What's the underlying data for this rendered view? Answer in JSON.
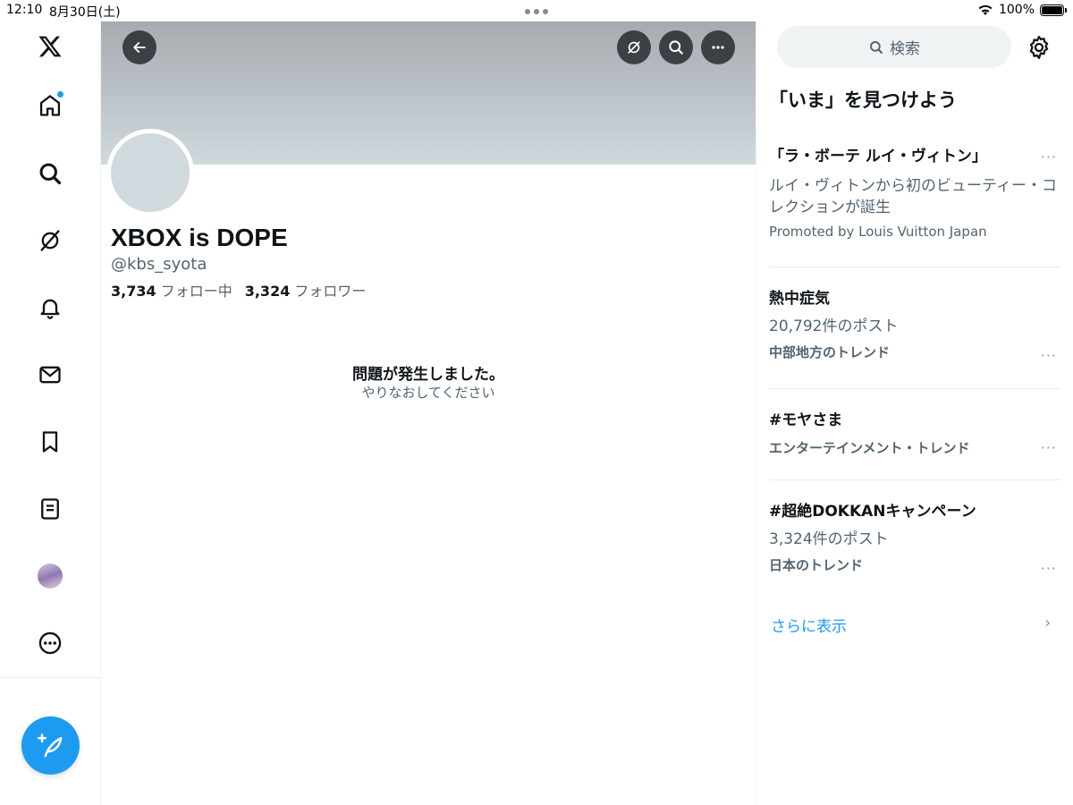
{
  "status_bar": {
    "time": "12:10",
    "date": "8月30日(土)",
    "battery": "100%"
  },
  "profile": {
    "display_name": "XBOX is DOPE",
    "handle": "@kbs_syota",
    "following_count": "3,734",
    "following_label": "フォロー中",
    "followers_count": "3,324",
    "followers_label": "フォロワー"
  },
  "error": {
    "title": "問題が発生しました。",
    "subtitle": "やりなおしてください"
  },
  "search": {
    "placeholder": "検索"
  },
  "explore": {
    "title": "「いま」を見つけよう",
    "trends": [
      {
        "title": "「ラ・ボーテ ルイ・ヴィトン」",
        "desc": "ルイ・ヴィトンから初のビューティー・コレクションが誕生",
        "meta": "Promoted by Louis Vuitton Japan"
      },
      {
        "title": "熱中症気",
        "desc": "20,792件のポスト",
        "meta": "中部地方のトレンド"
      },
      {
        "title": "#モヤさま",
        "desc": "",
        "meta": "エンターテインメント・トレンド"
      },
      {
        "title": "#超絶DOKKANキャンペーン",
        "desc": "3,324件のポスト",
        "meta": "日本のトレンド"
      }
    ],
    "more_glyph": "···",
    "show_more": "さらに表示"
  },
  "colors": {
    "accent": "#1d9bf0",
    "text": "#0f1419",
    "muted": "#536471"
  }
}
